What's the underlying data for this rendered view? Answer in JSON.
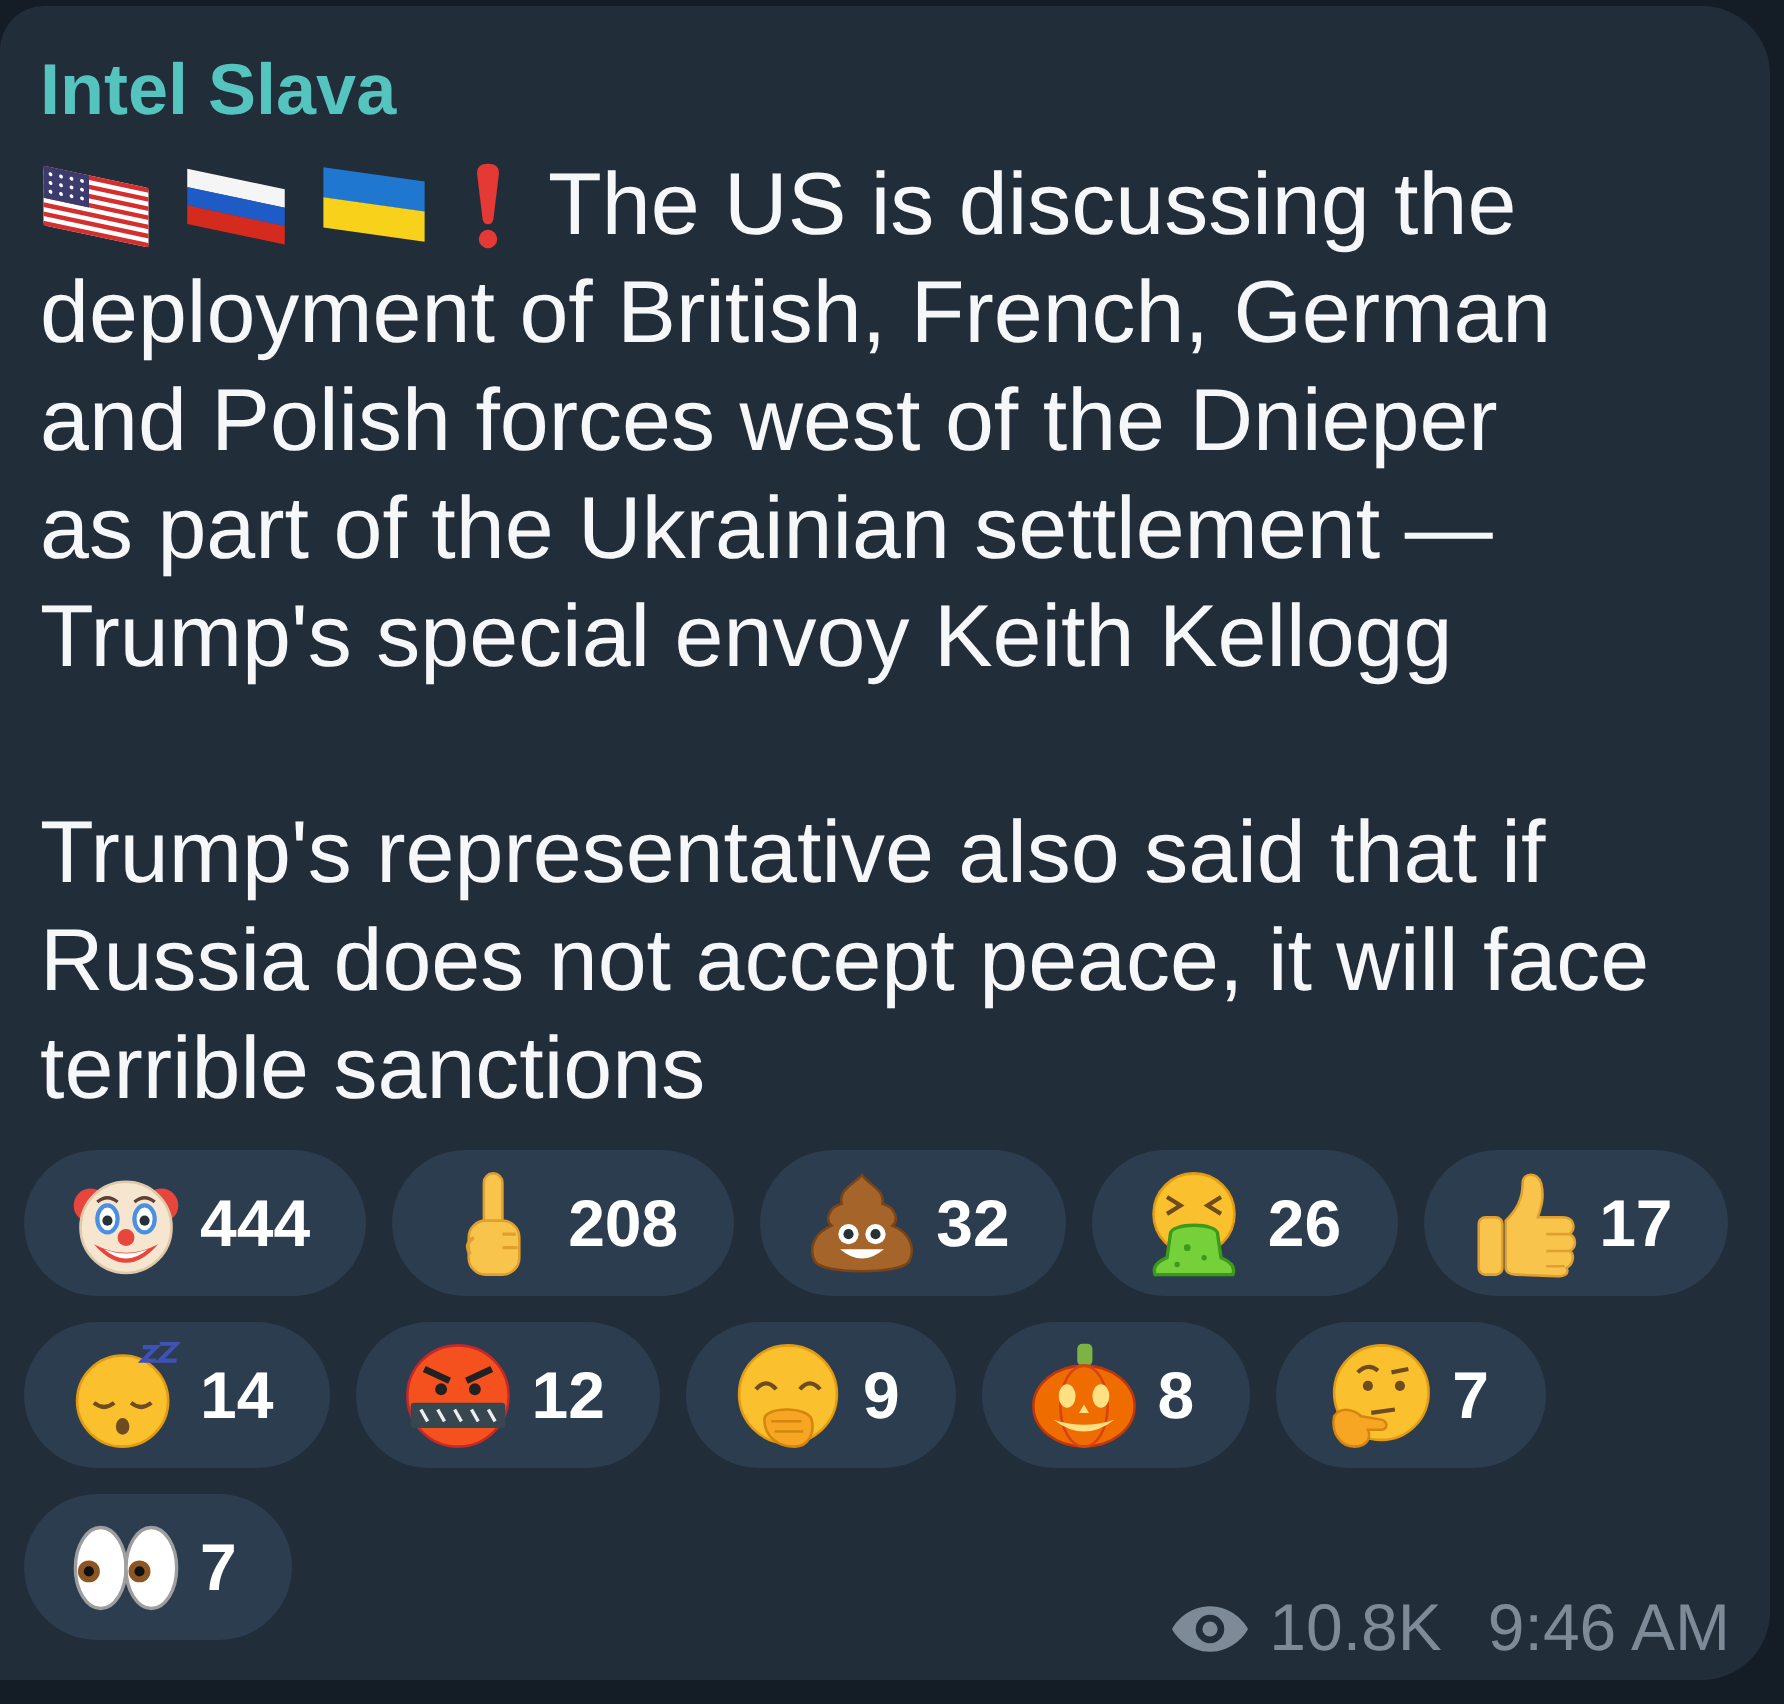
{
  "message": {
    "channel": "Intel Slava",
    "intro": {
      "icons": [
        {
          "kind": "flag_us"
        },
        {
          "kind": "flag_ru"
        },
        {
          "kind": "flag_ua"
        },
        {
          "kind": "exclamation"
        }
      ],
      "text": "The US is discussing the"
    },
    "paragraphs": [
      "deployment of British, French, German and Polish forces west of the Dnieper as part of the Ukrainian settlement — Trump's special envoy Keith Kellogg",
      "Trump's representative also said that if Russia does not accept peace, it will face terrible sanctions"
    ],
    "reactions": [
      {
        "kind": "clown",
        "count": "444"
      },
      {
        "kind": "middle_finger",
        "count": "208"
      },
      {
        "kind": "poop",
        "count": "32"
      },
      {
        "kind": "vomiting",
        "count": "26"
      },
      {
        "kind": "thumbs_up",
        "count": "17"
      },
      {
        "kind": "sleeping",
        "count": "14"
      },
      {
        "kind": "cursing",
        "count": "12"
      },
      {
        "kind": "yawning",
        "count": "9"
      },
      {
        "kind": "pumpkin",
        "count": "8"
      },
      {
        "kind": "thinking",
        "count": "7"
      },
      {
        "kind": "eyes",
        "count": "7"
      }
    ],
    "views": "10.8K",
    "time": "9:46 AM"
  }
}
